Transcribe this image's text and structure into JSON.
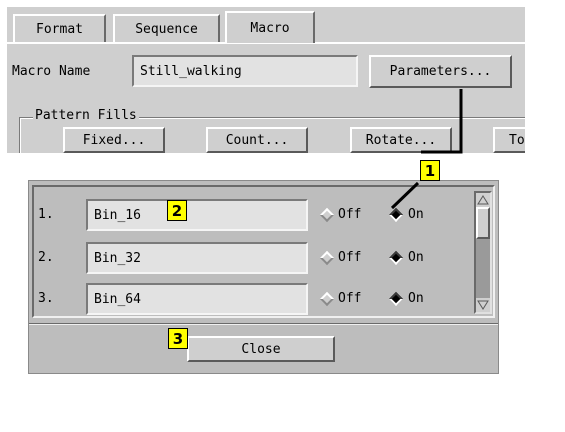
{
  "tabs": [
    {
      "label": "Format",
      "active": false
    },
    {
      "label": "Sequence",
      "active": false
    },
    {
      "label": "Macro",
      "active": true
    }
  ],
  "macro_name": {
    "label": "Macro Name",
    "value": "Still_walking"
  },
  "parameters_button": "Parameters...",
  "pattern_fills": {
    "title": "Pattern Fills",
    "buttons": [
      "Fixed...",
      "Count...",
      "Rotate...",
      "Tog"
    ]
  },
  "parameters_dialog": {
    "rows": [
      {
        "number": "1.",
        "name": "Bin_16",
        "off_label": "Off",
        "on_label": "On",
        "selected": "On"
      },
      {
        "number": "2.",
        "name": "Bin_32",
        "off_label": "Off",
        "on_label": "On",
        "selected": "On"
      },
      {
        "number": "3.",
        "name": "Bin_64",
        "off_label": "Off",
        "on_label": "On",
        "selected": "On"
      }
    ],
    "close_button": "Close"
  },
  "callouts": [
    "1",
    "2",
    "3"
  ],
  "colors": {
    "callout": "#ffff00",
    "panel": "#cfcfcf",
    "dialog": "#bdbdbd"
  }
}
